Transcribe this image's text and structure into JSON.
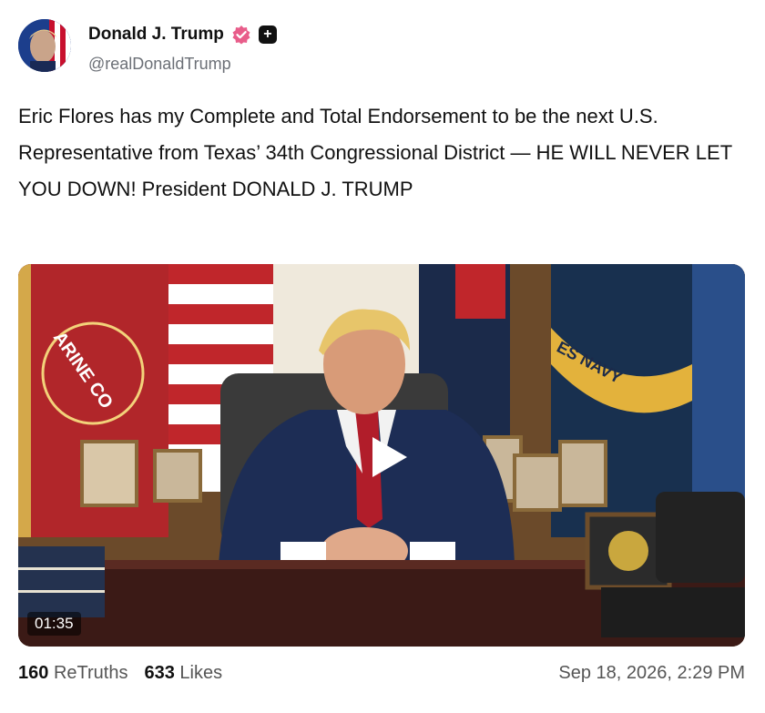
{
  "post": {
    "author_name": "Donald J. Trump",
    "handle": "@realDonaldTrump",
    "text": "Eric Flores has my Complete and Total Endorsement to be the next U.S. Representative from Texas’ 34th Congressional District — HE WILL NEVER LET YOU DOWN! President DONALD J. TRUMP",
    "plus_badge": "+"
  },
  "video": {
    "duration": "01:35",
    "flag_text_left": "ARINE CO",
    "flag_text_right": "ES NAVY"
  },
  "stats": {
    "retruths_count": "160",
    "retruths_label": "ReTruths",
    "likes_count": "633",
    "likes_label": "Likes"
  },
  "timestamp": "Sep 18, 2026, 2:29 PM",
  "colors": {
    "verified": "#e85d8a",
    "text": "#111111",
    "muted": "#6b6f76"
  }
}
